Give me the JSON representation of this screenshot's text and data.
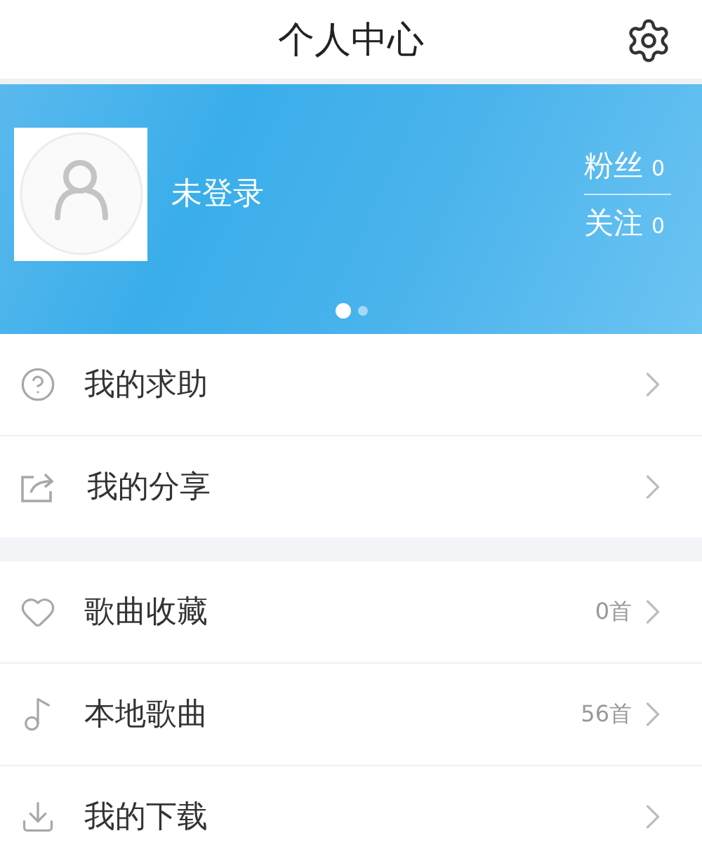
{
  "header": {
    "title": "个人中心"
  },
  "profile": {
    "name": "未登录",
    "stats": [
      {
        "label": "粉丝",
        "count": "0"
      },
      {
        "label": "关注",
        "count": "0"
      }
    ],
    "pages": [
      {
        "selected": true
      },
      {
        "selected": false
      }
    ]
  },
  "sections": [
    {
      "items": [
        {
          "label": "我的求助"
        },
        {
          "label": "我的分享"
        }
      ]
    },
    {
      "items": [
        {
          "label": "歌曲收藏",
          "count": "0首"
        },
        {
          "label": "本地歌曲",
          "count": "56首"
        },
        {
          "label": "我的下载"
        }
      ]
    }
  ]
}
